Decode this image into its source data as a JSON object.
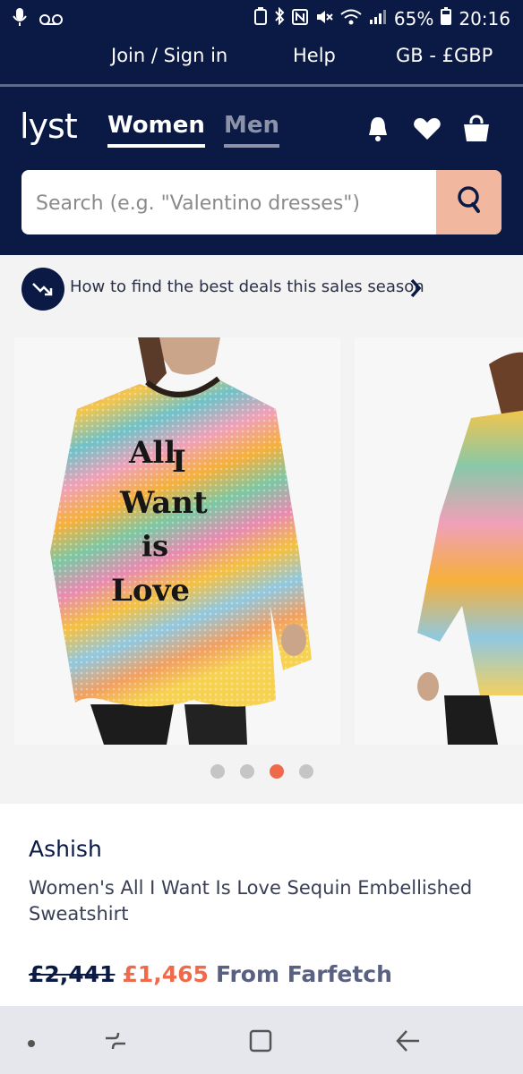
{
  "status_bar": {
    "battery": "65%",
    "time": "20:16"
  },
  "top_links": {
    "join_sign_in": "Join / Sign in",
    "help": "Help",
    "currency": "GB - £GBP"
  },
  "header": {
    "logo": "lyst",
    "tabs": [
      {
        "label": "Women",
        "active": true
      },
      {
        "label": "Men",
        "active": false
      }
    ],
    "search_placeholder": "Search (e.g. \"Valentino dresses\")",
    "brand_color": "#0b1a45",
    "search_button_color": "#f2b79f"
  },
  "promo": {
    "text": "How to find the best deals this sales season"
  },
  "carousel": {
    "dot_count": 4,
    "active_dot": 3,
    "active_color": "#ef6a4a",
    "print_lines": [
      "All",
      "I",
      "Want",
      "is",
      "Love"
    ]
  },
  "product": {
    "brand": "Ashish",
    "name": "Women's All I Want Is Love Sequin Embellished Sweatshirt",
    "original_price": "£2,441",
    "sale_price": "£1,465",
    "retailer": "From Farfetch",
    "sale_color": "#ef6a4a"
  },
  "icons": [
    "microphone-icon",
    "voicemail-icon",
    "bell-icon",
    "heart-icon",
    "bag-icon",
    "search-icon",
    "trend-down-icon",
    "chevron-right-icon",
    "recent-apps-icon",
    "home-icon",
    "back-icon"
  ]
}
